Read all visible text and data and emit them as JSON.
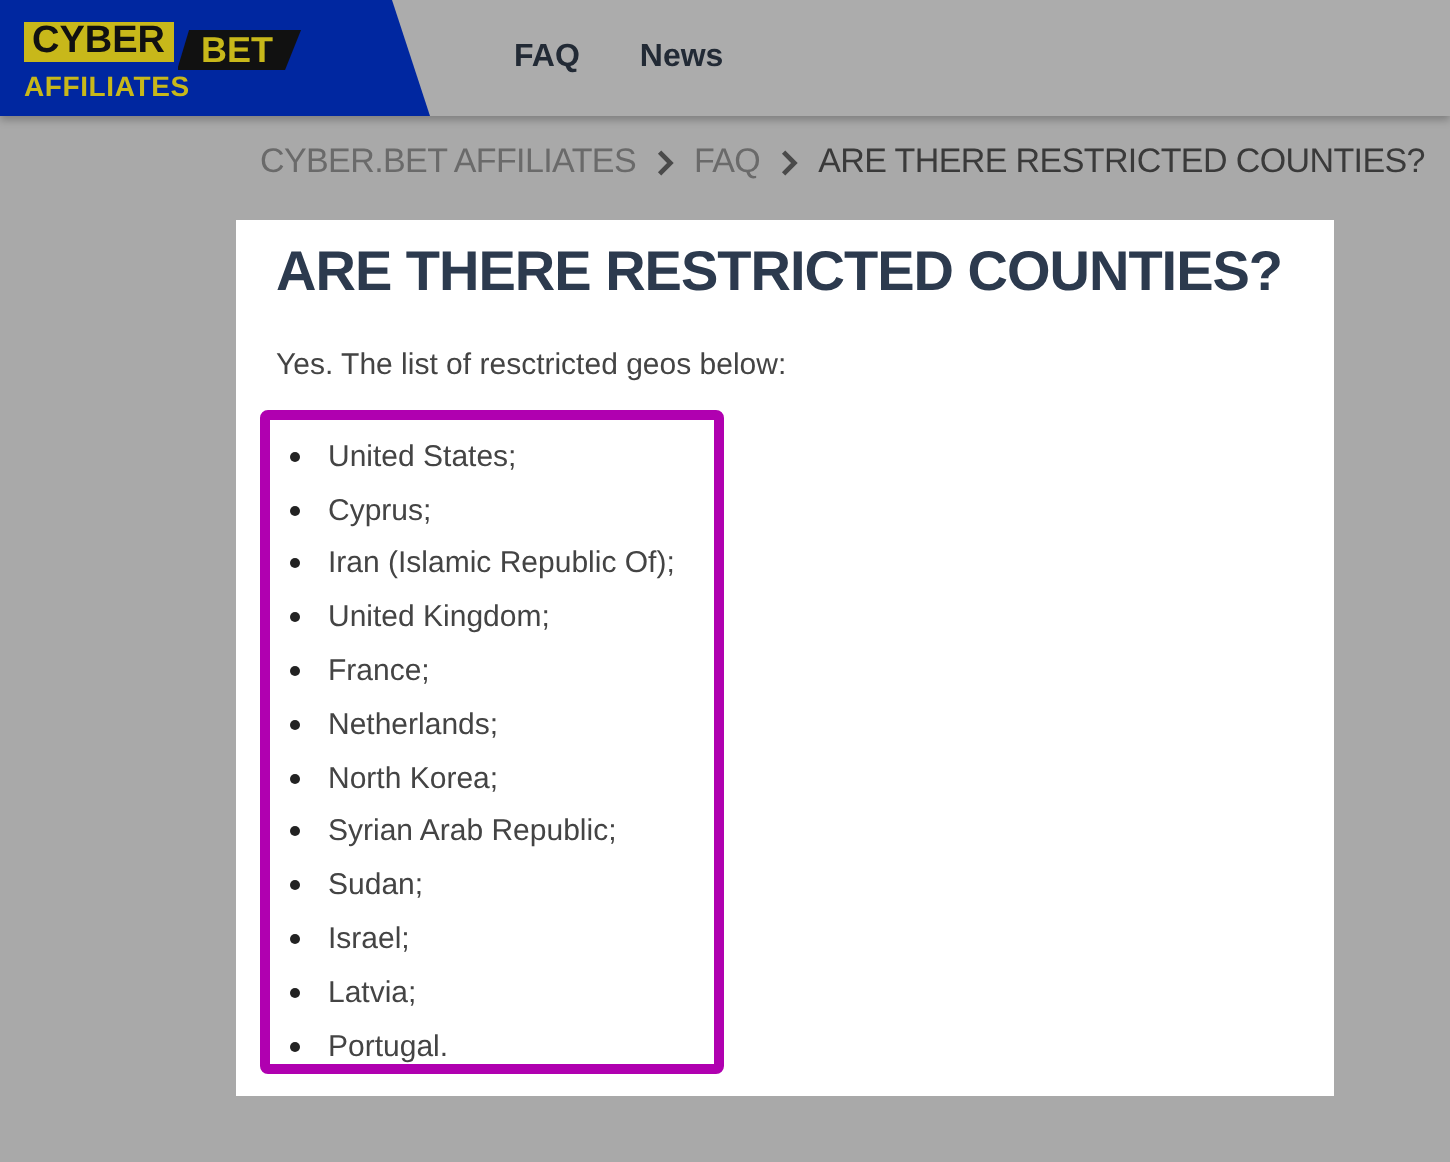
{
  "header": {
    "logo": {
      "word_1": "CYBER",
      "word_2": "BET",
      "word_3": "AFFILIATES"
    },
    "nav": [
      {
        "label": "FAQ"
      },
      {
        "label": "News"
      }
    ]
  },
  "breadcrumb": [
    {
      "label": "CYBER.BET AFFILIATES",
      "current": false
    },
    {
      "label": "FAQ",
      "current": false
    },
    {
      "label": "ARE THERE RESTRICTED COUNTIES?",
      "current": true
    }
  ],
  "article": {
    "title": "ARE THERE RESTRICTED COUNTIES?",
    "intro": "Yes. The list of resctricted geos below:",
    "highlighted": true,
    "items": [
      "United States;",
      "Cyprus;",
      "Iran (Islamic Republic Of);",
      "United Kingdom;",
      "France;",
      "Netherlands;",
      "North Korea;",
      "Syrian Arab Republic;",
      "Sudan;",
      "Israel;",
      "Latvia;",
      "Portugal."
    ]
  }
}
